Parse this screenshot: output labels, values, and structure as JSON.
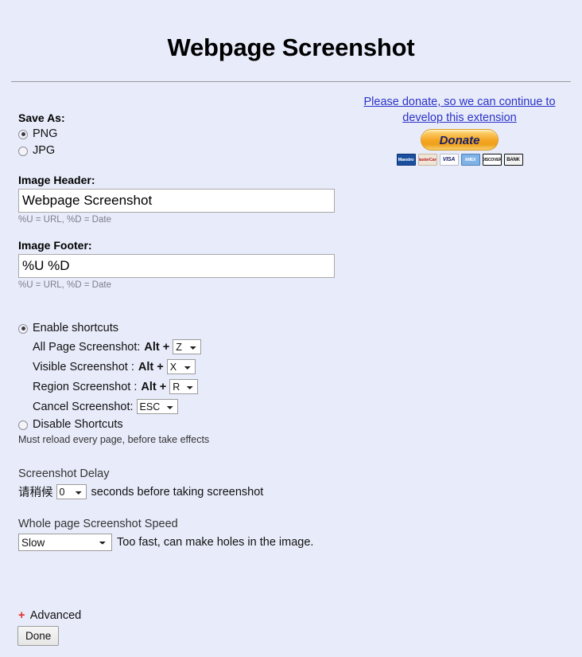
{
  "page": {
    "title": "Webpage Screenshot"
  },
  "donate": {
    "link_line1": "Please donate, so we can continue to",
    "link_line2": "develop this extension",
    "button_label": "Donate",
    "cards": [
      {
        "name": "maestro",
        "label": "Maestro"
      },
      {
        "name": "mastercard",
        "label": "MasterCard"
      },
      {
        "name": "visa",
        "label": "VISA"
      },
      {
        "name": "amex",
        "label": "AMEX"
      },
      {
        "name": "discover",
        "label": "DISCOVER"
      },
      {
        "name": "bank",
        "label": "BANK"
      }
    ]
  },
  "save_as": {
    "label": "Save As:",
    "options": [
      {
        "value": "png",
        "label": "PNG",
        "selected": true
      },
      {
        "value": "jpg",
        "label": "JPG",
        "selected": false
      }
    ]
  },
  "image_header": {
    "label": "Image Header:",
    "value": "Webpage Screenshot",
    "placeholder": "",
    "hint": "%U = URL, %D = Date"
  },
  "image_footer": {
    "label": "Image Footer:",
    "value": "%U %D",
    "placeholder": "",
    "hint": "%U = URL, %D = Date"
  },
  "shortcuts": {
    "enable_label": "Enable shortcuts",
    "enable_selected": true,
    "disable_label": "Disable Shortcuts",
    "disable_selected": false,
    "note": "Must reload every page, before take effects",
    "rows": [
      {
        "label": "All Page Screenshot:",
        "modifier": "Alt +",
        "value": "Z"
      },
      {
        "label": "Visible Screenshot :",
        "modifier": "Alt +",
        "value": "X"
      },
      {
        "label": "Region Screenshot :",
        "modifier": "Alt +",
        "value": "R"
      }
    ],
    "cancel": {
      "label": "Cancel Screenshot:",
      "value": "ESC"
    }
  },
  "delay": {
    "title": "Screenshot Delay",
    "prefix": "请稍候",
    "value": "0",
    "suffix": "seconds before taking screenshot"
  },
  "speed": {
    "title": "Whole page Screenshot Speed",
    "value": "Slow",
    "note": "Too fast, can make holes in the image."
  },
  "footer": {
    "advanced_plus": "+",
    "advanced_label": "Advanced",
    "done_label": "Done"
  },
  "colors": {
    "background": "#e8ecfa",
    "link": "#2b32c8",
    "donate_accent": "#f5a623",
    "plus_red": "#e03030"
  }
}
